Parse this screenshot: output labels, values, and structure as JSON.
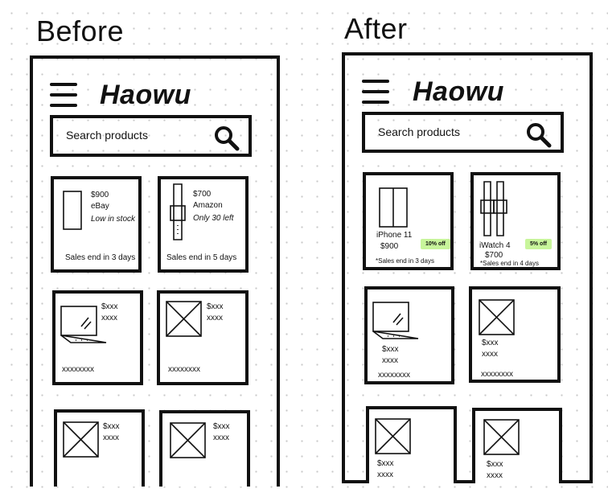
{
  "labels": {
    "before": "Before",
    "after": "After"
  },
  "app": {
    "logo": "Haowu",
    "search_placeholder": "Search products"
  },
  "before": {
    "featured": [
      {
        "price": "$900",
        "store": "eBay",
        "stock": "Low in stock",
        "footer": "Sales end in 3 days",
        "icon": "phone-icon"
      },
      {
        "price": "$700",
        "store": "Amazon",
        "stock": "Only 30 left",
        "footer": "Sales end in 5 days",
        "icon": "watch-icon"
      }
    ],
    "placeholders": [
      {
        "price": "$xxx",
        "line": "xxxx",
        "footer": "xxxxxxxx",
        "icon": "laptop-icon"
      },
      {
        "price": "$xxx",
        "line": "xxxx",
        "footer": "xxxxxxxx",
        "icon": "image-placeholder-icon"
      },
      {
        "price": "$xxx",
        "line": "xxxx",
        "icon": "image-placeholder-icon"
      },
      {
        "price": "$xxx",
        "line": "xxxx",
        "icon": "image-placeholder-icon"
      }
    ]
  },
  "after": {
    "featured": [
      {
        "name": "iPhone 11",
        "price": "$900",
        "discount": "10% off",
        "note": "*Sales end in 3 days",
        "icon": "phone-icon"
      },
      {
        "name": "iWatch 4",
        "price": "$700",
        "discount": "5% off",
        "note": "*Sales end in 4 days",
        "icon": "watch-icon"
      }
    ],
    "placeholders": [
      {
        "price": "$xxx",
        "line": "xxxx",
        "footer": "xxxxxxxx",
        "icon": "laptop-icon"
      },
      {
        "price": "$xxx",
        "line": "xxxx",
        "footer": "xxxxxxxx",
        "icon": "image-placeholder-icon"
      },
      {
        "price": "$xxx",
        "line": "xxxx",
        "icon": "image-placeholder-icon"
      },
      {
        "price": "$xxx",
        "line": "xxxx",
        "icon": "image-placeholder-icon"
      }
    ]
  },
  "colors": {
    "discount_badge": "#c8f59b",
    "stroke": "#111111",
    "grid_dot": "#c9c9c9"
  }
}
